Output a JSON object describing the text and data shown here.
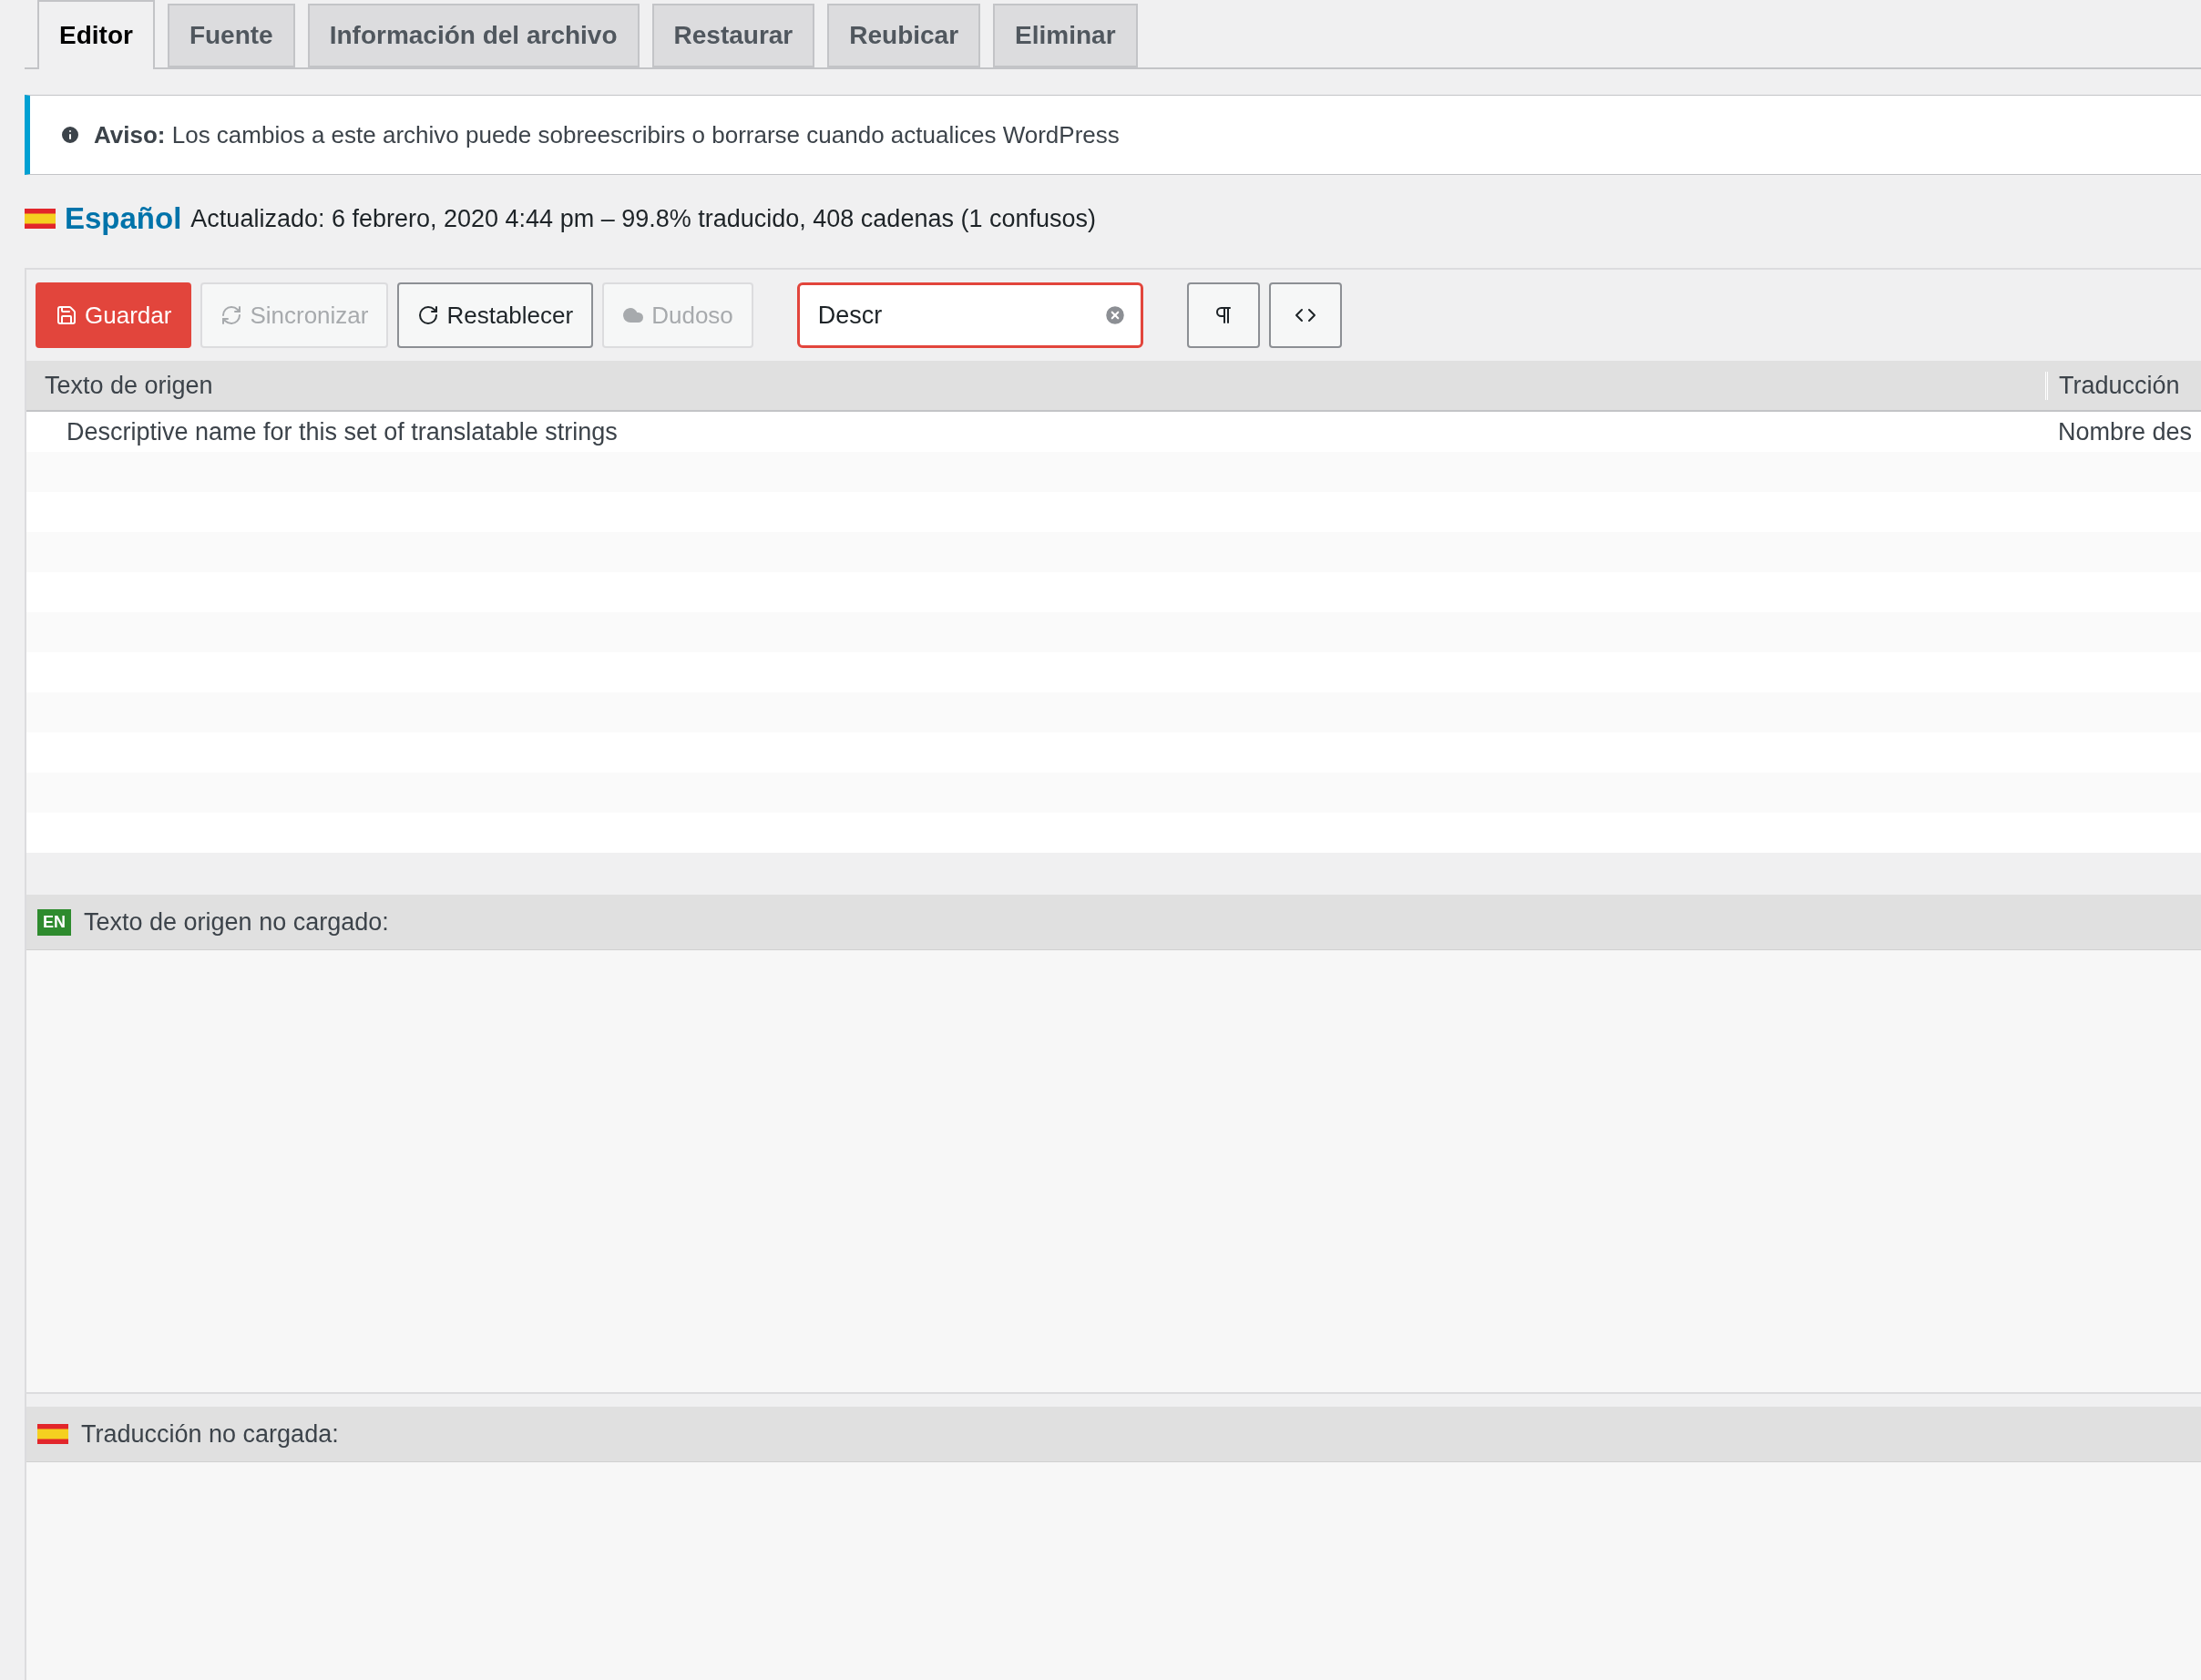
{
  "tabs": [
    {
      "label": "Editor",
      "selected": true
    },
    {
      "label": "Fuente",
      "selected": false
    },
    {
      "label": "Información del archivo",
      "selected": false
    },
    {
      "label": "Restaurar",
      "selected": false
    },
    {
      "label": "Reubicar",
      "selected": false
    },
    {
      "label": "Eliminar",
      "selected": false
    }
  ],
  "notice": {
    "text": "**Aviso:** Los cambios a este archivo puede sobreescribirs o borrarse cuando actualices WordPress"
  },
  "language": {
    "name": "Español",
    "details": "Actualizado: 6 febrero, 2020 4:44 pm – 99.8% traducido, 408 cadenas (1 confusos)"
  },
  "toolbar": {
    "buttons": [
      {
        "kind": "save",
        "label": "Guardar",
        "disabled": false
      },
      {
        "kind": "sync",
        "label": "Sincronizar",
        "disabled": true
      },
      {
        "kind": "revert",
        "label": "Restablecer",
        "disabled": false
      },
      {
        "kind": "fuzzy",
        "label": "Dudoso",
        "disabled": true
      }
    ],
    "search": {
      "value": "Descr"
    },
    "tools": [
      {
        "kind": "invisibles"
      },
      {
        "kind": "code"
      }
    ]
  },
  "table": {
    "columns": [
      "Texto de origen",
      "Traducción"
    ],
    "rows": [
      {
        "source": "Descriptive name for this set of translatable strings",
        "translation": "Nombre des"
      }
    ]
  },
  "source_panel": {
    "badge": "EN",
    "title": "Texto de origen no cargado:"
  },
  "translation_panel": {
    "title": "Traducción no cargada:"
  }
}
